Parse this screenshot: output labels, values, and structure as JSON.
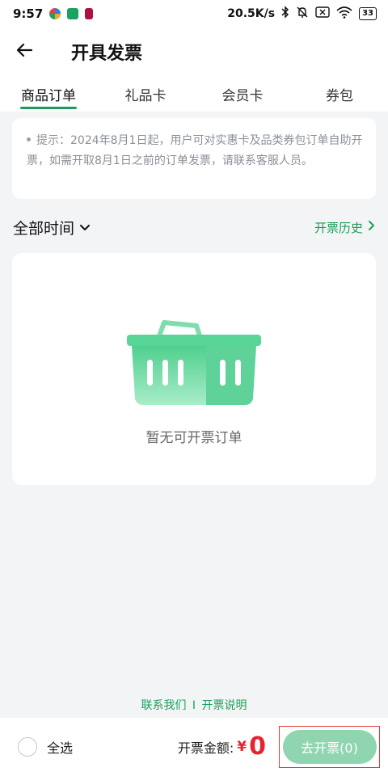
{
  "status_bar": {
    "time": "9:57",
    "network_speed": "20.5K/s",
    "battery": "33"
  },
  "header": {
    "title": "开具发票",
    "back_icon": "arrow-left-icon"
  },
  "tabs": [
    {
      "label": "商品订单",
      "active": true
    },
    {
      "label": "礼品卡",
      "active": false
    },
    {
      "label": "会员卡",
      "active": false
    },
    {
      "label": "券包",
      "active": false
    }
  ],
  "notice": {
    "text": "提示：2024年8月1日起，用户可对实惠卡及品类券包订单自助开票，如需开取8月1日之前的订单发票，请联系客服人员。"
  },
  "filter": {
    "time_label": "全部时间",
    "history_label": "开票历史"
  },
  "empty_state": {
    "text": "暂无可开票订单",
    "icon": "basket-icon"
  },
  "links": {
    "contact": "联系我们",
    "separator": "I",
    "instructions": "开票说明"
  },
  "bottom_bar": {
    "select_all_label": "全选",
    "amount_label": "开票金额:",
    "currency": "¥",
    "amount": "0",
    "issue_button_label": "去开票(0)"
  },
  "colors": {
    "accent": "#1a9e5a",
    "price": "#e8222e",
    "button_disabled": "#8fd5b0"
  }
}
